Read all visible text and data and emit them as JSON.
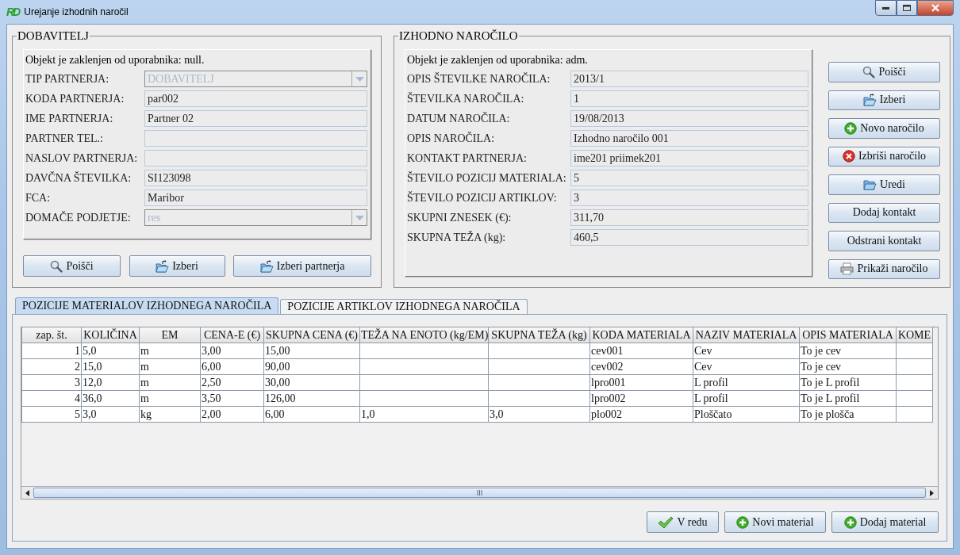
{
  "window": {
    "logo": "RD",
    "title": "Urejanje izhodnih naročil"
  },
  "supplier": {
    "title": "DOBAVITELJ",
    "lock_note": "Objekt je zaklenjen od uporabnika: null.",
    "fields": [
      {
        "label": "TIP PARTNERJA:",
        "value": "DOBAVITELJ",
        "kind": "combo",
        "disabled": true
      },
      {
        "label": "KODA PARTNERJA:",
        "value": "par002",
        "kind": "text"
      },
      {
        "label": "IME PARTNERJA:",
        "value": "Partner 02",
        "kind": "text"
      },
      {
        "label": "PARTNER TEL.:",
        "kind": "text"
      },
      {
        "label": "NASLOV PARTNERJA:",
        "kind": "text"
      },
      {
        "label": "DAVČNA ŠTEVILKA:",
        "value": "SI123098",
        "kind": "text"
      },
      {
        "label": "FCA:",
        "value": "Maribor",
        "kind": "text"
      },
      {
        "label": "DOMAČE PODJETJE:",
        "value": "res",
        "kind": "combo",
        "disabled": true
      }
    ],
    "buttons": [
      {
        "label": "Poišči",
        "kind": "search"
      },
      {
        "label": "Izberi",
        "kind": "pick"
      },
      {
        "label": "Izberi partnerja",
        "kind": "pick"
      }
    ]
  },
  "order": {
    "title": "IZHODNO NAROČILO",
    "lock_note": "Objekt je zaklenjen od uporabnika: adm.",
    "fields": [
      {
        "label": "OPIS ŠTEVILKE NAROČILA:",
        "value": "2013/1"
      },
      {
        "label": "ŠTEVILKA NAROČILA:",
        "value": "1"
      },
      {
        "label": "DATUM NAROČILA:",
        "value": "19/08/2013"
      },
      {
        "label": "OPIS NAROČILA:",
        "value": "Izhodno naročilo 001"
      },
      {
        "label": "KONTAKT PARTNERJA:",
        "value": "ime201 priimek201"
      },
      {
        "label": "ŠTEVILO POZICIJ MATERIALA:",
        "value": "5"
      },
      {
        "label": "ŠTEVILO POZICIJ ARTIKLOV:",
        "value": "3"
      },
      {
        "label": "SKUPNI ZNESEK (€):",
        "value": "311,70"
      },
      {
        "label": "SKUPNA TEŽA (kg):",
        "value": "460,5"
      }
    ],
    "buttons": [
      {
        "label": "Poišči",
        "kind": "search"
      },
      {
        "label": "Izberi",
        "kind": "pick"
      },
      {
        "label": "Novo naročilo",
        "kind": "add"
      },
      {
        "label": "Izbriši naročilo",
        "kind": "delete"
      },
      {
        "label": "Uredi",
        "kind": "edit"
      },
      {
        "label": "Dodaj kontakt",
        "kind": "plain"
      },
      {
        "label": "Odstrani kontakt",
        "kind": "plain"
      },
      {
        "label": "Prikaži naročilo",
        "kind": "print"
      }
    ]
  },
  "tabs": [
    {
      "label": "POZICIJE MATERIALOV IZHODNEGA NAROČILA",
      "selected": true
    },
    {
      "label": "POZICIJE ARTIKLOV IZHODNEGA NAROČILA",
      "selected": false
    }
  ],
  "table": {
    "columns": [
      "zap. št.",
      "KOLIČINA",
      "EM",
      "CENA-E (€)",
      "SKUPNA CENA (€)",
      "TEŽA NA ENOTO (kg/EM)",
      "SKUPNA TEŽA (kg)",
      "KODA MATERIALA",
      "NAZIV MATERIALA",
      "OPIS MATERIALA",
      "KOME"
    ],
    "rows": [
      [
        "1",
        "5,0",
        "m",
        "3,00",
        "15,00",
        null,
        null,
        "cev001",
        "Cev",
        "To je cev",
        null
      ],
      [
        "2",
        "15,0",
        "m",
        "6,00",
        "90,00",
        null,
        null,
        "cev002",
        "Cev",
        "To je cev",
        null
      ],
      [
        "3",
        "12,0",
        "m",
        "2,50",
        "30,00",
        null,
        null,
        "lpro001",
        "L profil",
        "To je L profil",
        null
      ],
      [
        "4",
        "36,0",
        "m",
        "3,50",
        "126,00",
        null,
        null,
        "lpro002",
        "L profil",
        "To je L profil",
        null
      ],
      [
        "5",
        "3,0",
        "kg",
        "2,00",
        "6,00",
        "1,0",
        "3,0",
        "plo002",
        "Ploščato",
        "To je plošča",
        null
      ]
    ]
  },
  "bottom_buttons": [
    {
      "label": "V redu",
      "kind": "ok"
    },
    {
      "label": "Novi material",
      "kind": "add"
    },
    {
      "label": "Dodaj material",
      "kind": "add"
    }
  ]
}
